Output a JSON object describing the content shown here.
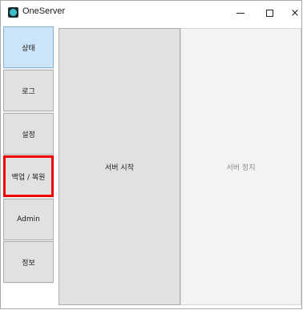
{
  "window": {
    "title": "OneServer",
    "controls": {
      "minimize": "minimize",
      "maximize": "maximize",
      "close": "×"
    }
  },
  "sidebar": {
    "items": [
      {
        "label": "상태",
        "state": "selected"
      },
      {
        "label": "로그",
        "state": "normal"
      },
      {
        "label": "설정",
        "state": "normal"
      },
      {
        "label": "백업 / 복원",
        "state": "highlighted"
      },
      {
        "label": "Admin",
        "state": "normal"
      },
      {
        "label": "정보",
        "state": "normal"
      }
    ]
  },
  "main": {
    "start_button": {
      "label": "서버 시작",
      "enabled": true
    },
    "stop_button": {
      "label": "서버 정지",
      "enabled": false
    }
  },
  "colors": {
    "selected_bg": "#cce4f7",
    "highlight_border": "#ee0000",
    "button_bg": "#e1e1e1",
    "disabled_text": "#8a8a8a"
  }
}
